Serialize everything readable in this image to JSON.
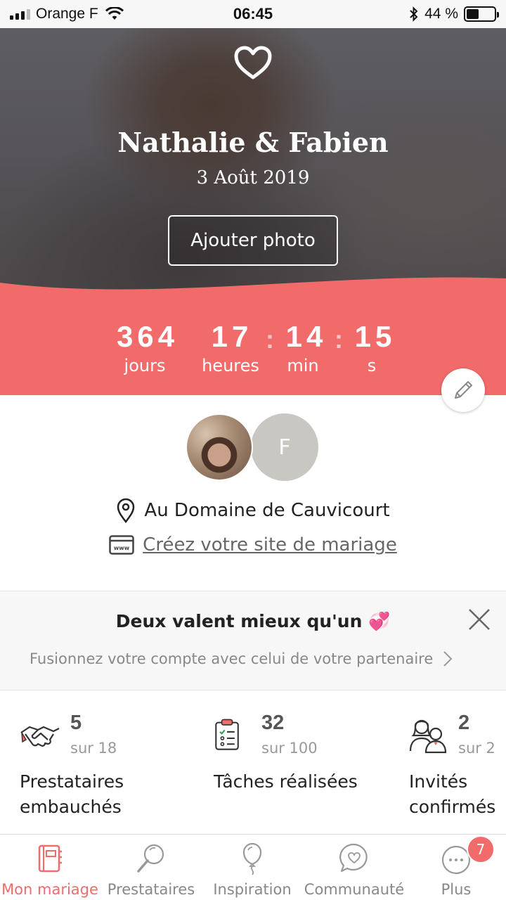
{
  "status_bar": {
    "carrier": "Orange F",
    "time": "06:45",
    "battery": "44 %",
    "battery_level": 0.44
  },
  "hero": {
    "couple": "Nathalie & Fabien",
    "date": "3 Août 2019",
    "add_photo_label": "Ajouter photo"
  },
  "countdown": {
    "days": "364",
    "days_label": "jours",
    "hours": "17",
    "hours_label": "heures",
    "minutes": "14",
    "minutes_label": "min",
    "seconds": "15",
    "seconds_label": "s",
    "separator": ":"
  },
  "profile": {
    "partner_initial": "F",
    "venue": "Au Domaine de Cauvicourt",
    "site_link": "Créez votre site de mariage"
  },
  "merge_banner": {
    "title": "Deux valent mieux qu'un 💞",
    "subtitle": "Fusionnez votre compte avec celui de votre partenaire"
  },
  "stats": [
    {
      "value": "5",
      "total": "sur 18",
      "label": "Prestataires embauchés",
      "icon": "handshake-icon"
    },
    {
      "value": "32",
      "total": "sur 100",
      "label": "Tâches réalisées",
      "icon": "checklist-icon"
    },
    {
      "value": "2",
      "total": "sur 2",
      "label": "Invités confirmés",
      "icon": "guests-icon"
    }
  ],
  "tabs": [
    {
      "label": "Mon mariage",
      "icon": "notebook-icon",
      "active": true
    },
    {
      "label": "Prestataires",
      "icon": "magnifier-icon",
      "active": false
    },
    {
      "label": "Inspiration",
      "icon": "balloon-icon",
      "active": false
    },
    {
      "label": "Communauté",
      "icon": "chat-heart-icon",
      "active": false
    },
    {
      "label": "Plus",
      "icon": "more-icon",
      "active": false,
      "badge": "7"
    }
  ],
  "colors": {
    "accent": "#f26b6b",
    "banner_bg": "#f7f7f7",
    "muted_text": "#888888"
  }
}
